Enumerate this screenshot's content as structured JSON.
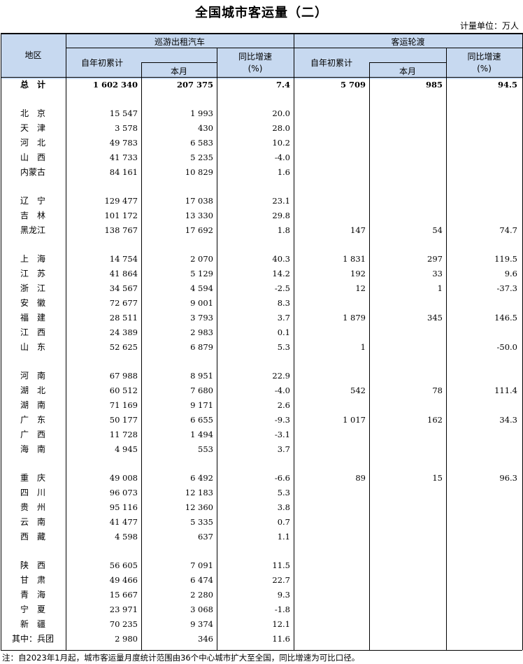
{
  "title": "全国城市客运量（二）",
  "unit": "计量单位：万人",
  "headers": {
    "region": "地区",
    "taxi": "巡游出租汽车",
    "ferry": "客运轮渡",
    "ytd": "自年初累计",
    "month": "本月",
    "yoy": "同比增速",
    "pct": "(%)"
  },
  "total": {
    "name": "总　计",
    "taxi_ytd": "1 602 340",
    "taxi_month": "207 375",
    "taxi_yoy": "7.4",
    "ferry_ytd": "5 709",
    "ferry_month": "985",
    "ferry_yoy": "94.5"
  },
  "rows": [
    {
      "name": "北　京",
      "taxi_ytd": "15 547",
      "taxi_month": "1 993",
      "taxi_yoy": "20.0",
      "ferry_ytd": "",
      "ferry_month": "",
      "ferry_yoy": ""
    },
    {
      "name": "天　津",
      "taxi_ytd": "3 578",
      "taxi_month": "430",
      "taxi_yoy": "28.0",
      "ferry_ytd": "",
      "ferry_month": "",
      "ferry_yoy": ""
    },
    {
      "name": "河　北",
      "taxi_ytd": "49 783",
      "taxi_month": "6 583",
      "taxi_yoy": "10.2",
      "ferry_ytd": "",
      "ferry_month": "",
      "ferry_yoy": ""
    },
    {
      "name": "山　西",
      "taxi_ytd": "41 733",
      "taxi_month": "5 235",
      "taxi_yoy": "-4.0",
      "ferry_ytd": "",
      "ferry_month": "",
      "ferry_yoy": ""
    },
    {
      "name": "内蒙古",
      "taxi_ytd": "84 161",
      "taxi_month": "10 829",
      "taxi_yoy": "1.6",
      "ferry_ytd": "",
      "ferry_month": "",
      "ferry_yoy": ""
    },
    {
      "name": "辽　宁",
      "taxi_ytd": "129 477",
      "taxi_month": "17 038",
      "taxi_yoy": "23.1",
      "ferry_ytd": "",
      "ferry_month": "",
      "ferry_yoy": ""
    },
    {
      "name": "吉　林",
      "taxi_ytd": "101 172",
      "taxi_month": "13 330",
      "taxi_yoy": "29.8",
      "ferry_ytd": "",
      "ferry_month": "",
      "ferry_yoy": ""
    },
    {
      "name": "黑龙江",
      "taxi_ytd": "138 767",
      "taxi_month": "17 692",
      "taxi_yoy": "1.8",
      "ferry_ytd": "147",
      "ferry_month": "54",
      "ferry_yoy": "74.7"
    },
    {
      "name": "上　海",
      "taxi_ytd": "14 754",
      "taxi_month": "2 070",
      "taxi_yoy": "40.3",
      "ferry_ytd": "1 831",
      "ferry_month": "297",
      "ferry_yoy": "119.5"
    },
    {
      "name": "江　苏",
      "taxi_ytd": "41 864",
      "taxi_month": "5 129",
      "taxi_yoy": "14.2",
      "ferry_ytd": "192",
      "ferry_month": "33",
      "ferry_yoy": "9.6"
    },
    {
      "name": "浙　江",
      "taxi_ytd": "34 567",
      "taxi_month": "4 594",
      "taxi_yoy": "-2.5",
      "ferry_ytd": "12",
      "ferry_month": "1",
      "ferry_yoy": "-37.3"
    },
    {
      "name": "安　徽",
      "taxi_ytd": "72 677",
      "taxi_month": "9 001",
      "taxi_yoy": "8.3",
      "ferry_ytd": "",
      "ferry_month": "",
      "ferry_yoy": ""
    },
    {
      "name": "福　建",
      "taxi_ytd": "28 511",
      "taxi_month": "3 793",
      "taxi_yoy": "3.7",
      "ferry_ytd": "1 879",
      "ferry_month": "345",
      "ferry_yoy": "146.5"
    },
    {
      "name": "江　西",
      "taxi_ytd": "24 389",
      "taxi_month": "2 983",
      "taxi_yoy": "0.1",
      "ferry_ytd": "",
      "ferry_month": "",
      "ferry_yoy": ""
    },
    {
      "name": "山　东",
      "taxi_ytd": "52 625",
      "taxi_month": "6 879",
      "taxi_yoy": "5.3",
      "ferry_ytd": "1",
      "ferry_month": "",
      "ferry_yoy": "-50.0"
    },
    {
      "name": "河　南",
      "taxi_ytd": "67 988",
      "taxi_month": "8 951",
      "taxi_yoy": "22.9",
      "ferry_ytd": "",
      "ferry_month": "",
      "ferry_yoy": ""
    },
    {
      "name": "湖　北",
      "taxi_ytd": "60 512",
      "taxi_month": "7 680",
      "taxi_yoy": "-4.0",
      "ferry_ytd": "542",
      "ferry_month": "78",
      "ferry_yoy": "111.4"
    },
    {
      "name": "湖　南",
      "taxi_ytd": "71 169",
      "taxi_month": "9 171",
      "taxi_yoy": "2.6",
      "ferry_ytd": "",
      "ferry_month": "",
      "ferry_yoy": ""
    },
    {
      "name": "广　东",
      "taxi_ytd": "50 177",
      "taxi_month": "6 655",
      "taxi_yoy": "-9.3",
      "ferry_ytd": "1 017",
      "ferry_month": "162",
      "ferry_yoy": "34.3"
    },
    {
      "name": "广　西",
      "taxi_ytd": "11 728",
      "taxi_month": "1 494",
      "taxi_yoy": "-3.1",
      "ferry_ytd": "",
      "ferry_month": "",
      "ferry_yoy": ""
    },
    {
      "name": "海　南",
      "taxi_ytd": "4 945",
      "taxi_month": "553",
      "taxi_yoy": "3.7",
      "ferry_ytd": "",
      "ferry_month": "",
      "ferry_yoy": ""
    },
    {
      "name": "重　庆",
      "taxi_ytd": "49 008",
      "taxi_month": "6 492",
      "taxi_yoy": "-6.6",
      "ferry_ytd": "89",
      "ferry_month": "15",
      "ferry_yoy": "96.3"
    },
    {
      "name": "四　川",
      "taxi_ytd": "96 073",
      "taxi_month": "12 183",
      "taxi_yoy": "5.3",
      "ferry_ytd": "",
      "ferry_month": "",
      "ferry_yoy": ""
    },
    {
      "name": "贵　州",
      "taxi_ytd": "95 116",
      "taxi_month": "12 360",
      "taxi_yoy": "3.8",
      "ferry_ytd": "",
      "ferry_month": "",
      "ferry_yoy": ""
    },
    {
      "name": "云　南",
      "taxi_ytd": "41 477",
      "taxi_month": "5 335",
      "taxi_yoy": "0.7",
      "ferry_ytd": "",
      "ferry_month": "",
      "ferry_yoy": ""
    },
    {
      "name": "西　藏",
      "taxi_ytd": "4 598",
      "taxi_month": "637",
      "taxi_yoy": "1.1",
      "ferry_ytd": "",
      "ferry_month": "",
      "ferry_yoy": ""
    },
    {
      "name": "陕　西",
      "taxi_ytd": "56 605",
      "taxi_month": "7 091",
      "taxi_yoy": "11.5",
      "ferry_ytd": "",
      "ferry_month": "",
      "ferry_yoy": ""
    },
    {
      "name": "甘　肃",
      "taxi_ytd": "49 466",
      "taxi_month": "6 474",
      "taxi_yoy": "22.7",
      "ferry_ytd": "",
      "ferry_month": "",
      "ferry_yoy": ""
    },
    {
      "name": "青　海",
      "taxi_ytd": "15 667",
      "taxi_month": "2 280",
      "taxi_yoy": "9.3",
      "ferry_ytd": "",
      "ferry_month": "",
      "ferry_yoy": ""
    },
    {
      "name": "宁　夏",
      "taxi_ytd": "23 971",
      "taxi_month": "3 068",
      "taxi_yoy": "-1.8",
      "ferry_ytd": "",
      "ferry_month": "",
      "ferry_yoy": ""
    },
    {
      "name": "新　疆",
      "taxi_ytd": "70 235",
      "taxi_month": "9 374",
      "taxi_yoy": "12.1",
      "ferry_ytd": "",
      "ferry_month": "",
      "ferry_yoy": ""
    },
    {
      "name": "其中：兵团",
      "taxi_ytd": "2 980",
      "taxi_month": "346",
      "taxi_yoy": "11.6",
      "ferry_ytd": "",
      "ferry_month": "",
      "ferry_yoy": ""
    }
  ],
  "note": "注：自2023年1月起，城市客运量月度统计范围由36个中心城市扩大至全国，同比增速为可比口径。"
}
